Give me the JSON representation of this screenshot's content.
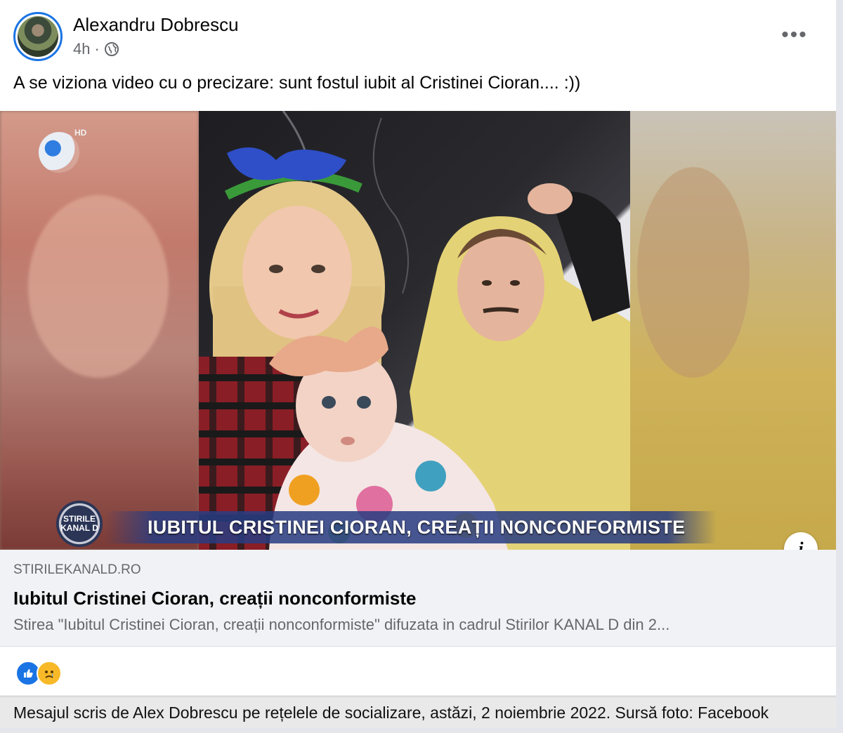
{
  "post": {
    "author": "Alexandru Dobrescu",
    "time": "4h",
    "meta_separator": "·",
    "text": "A se viziona video cu o precizare: sunt fostul iubit al Cristinei Cioran.... :))",
    "more_icon": "more-horizontal-icon",
    "more_label": "•••"
  },
  "media": {
    "hd_label": "HD",
    "badge_label": "STIRILE KANAL D",
    "ticker": "IUBITUL CRISTINEI CIORAN, CREAȚII NONCONFORMISTE",
    "info_label": "i"
  },
  "link_preview": {
    "domain": "STIRILEKANALD.RO",
    "title": "Iubitul Cristinei Cioran, creații nonconformiste",
    "description": "Stirea \"Iubitul Cristinei Cioran, creații nonconformiste\" difuzata in cadrul Stirilor KANAL D din 2..."
  },
  "reactions": {
    "icons": [
      "like-icon",
      "sad-icon"
    ]
  },
  "caption": "Mesajul scris de Alex Dobrescu pe rețelele de socializare, astăzi, 2 noiembrie 2022. Sursă foto: Facebook",
  "colors": {
    "accent": "#1b74e4",
    "secondary_text": "#65676b",
    "link_bg": "#f0f2f5",
    "ticker_bg": "#283c82"
  }
}
